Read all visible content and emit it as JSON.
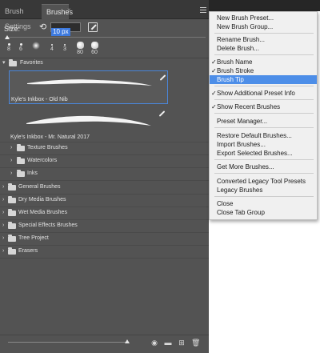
{
  "tabs": {
    "settings": "Brush Settings",
    "brushes": "Brushes",
    "close": "×"
  },
  "size": {
    "label": "Size:",
    "value": "10 px"
  },
  "presets": [
    {
      "number": "8"
    },
    {
      "number": "6"
    },
    {
      "number": ""
    },
    {
      "number": "4"
    },
    {
      "number": "3"
    },
    {
      "number": "80"
    },
    {
      "number": "60"
    }
  ],
  "tree": {
    "favorites": "Favorites",
    "brush_1": "Kyle's Inkbox - Old Nib",
    "brush_2": "Kyle's Inkbox - Mr. Natural 2017",
    "sub_groups": [
      "Texture Brushes",
      "Watercolors",
      "Inks"
    ],
    "groups": [
      "General Brushes",
      "Dry Media Brushes",
      "Wet Media Brushes",
      "Special Effects Brushes",
      "Tree Project",
      "Erasers"
    ]
  },
  "menu": {
    "new_preset": "New Brush Preset...",
    "new_group": "New Brush Group...",
    "rename": "Rename Brush...",
    "delete": "Delete Brush...",
    "brush_name": "Brush Name",
    "brush_stroke": "Brush Stroke",
    "brush_tip": "Brush Tip",
    "additional_info": "Show Additional Preset Info",
    "recent": "Show Recent Brushes",
    "preset_manager": "Preset Manager...",
    "restore": "Restore Default Brushes...",
    "import": "Import Brushes...",
    "export": "Export Selected Brushes...",
    "get_more": "Get More Brushes...",
    "converted_legacy": "Converted Legacy Tool Presets",
    "legacy": "Legacy Brushes",
    "close": "Close",
    "close_group": "Close Tab Group",
    "check": "✓"
  },
  "colors": {
    "panel": "#535353",
    "selection": "#4a86d9",
    "menu_highlight": "#4d8ee8"
  },
  "icons": {
    "reset": "reset-arrow-icon",
    "edit": "brush-edit-icon",
    "folder": "folder-icon",
    "chevron_down": "chevron-down-icon",
    "chevron_right": "chevron-right-icon",
    "tool": "brush-tool-icon",
    "visibility": "eye-icon",
    "new_group": "new-folder-icon",
    "new_brush": "new-brush-icon",
    "trash": "trash-icon"
  }
}
